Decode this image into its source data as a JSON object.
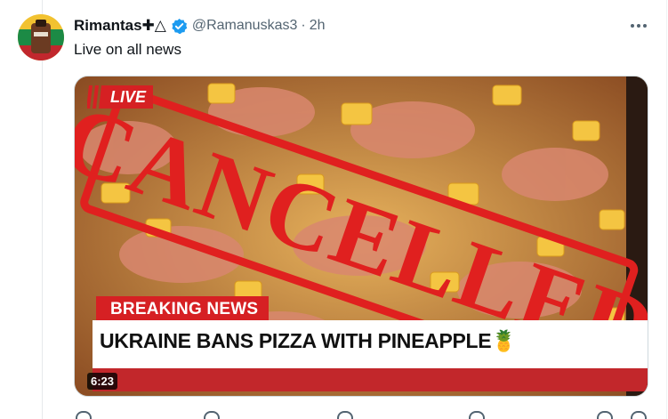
{
  "tweet": {
    "display_name": "Rimantas✚△",
    "handle": "@Ramanuskas3",
    "separator": "·",
    "time": "2h",
    "text": "Live on all news",
    "verified_icon": "verified-badge-icon",
    "more_icon": "more-icon"
  },
  "media": {
    "live_label": "LIVE",
    "stamp_text": "CANCELLED",
    "breaking_label": "BREAKING NEWS",
    "headline": "UKRAINE BANS PIZZA WITH PINEAPPLE🍍",
    "duration": "6:23"
  },
  "colors": {
    "accent_blue": "#1d9bf0",
    "news_red": "#d62023",
    "stamp_red": "#e0201f",
    "text_secondary": "#536471"
  }
}
